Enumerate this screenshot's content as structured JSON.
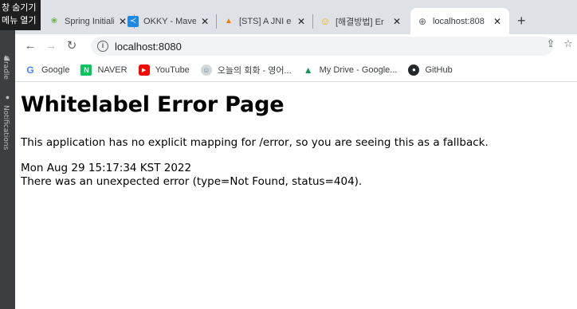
{
  "ide": {
    "tooltip_lines": [
      "창 숨기기",
      "메뉴 열기"
    ],
    "side_tabs": [
      "Gradle",
      "Notifications"
    ]
  },
  "browser": {
    "tabs": [
      {
        "title": "Spring Initiali",
        "favicon": "spring-icon",
        "color": "#6db33f"
      },
      {
        "title": "OKKY - Mave",
        "favicon": "okky-icon",
        "color": "#1e88e5"
      },
      {
        "title": "[STS] A JNI e",
        "favicon": "flame-icon",
        "color": "#f57c00"
      },
      {
        "title": "[해결방법] Er",
        "favicon": "smiley-icon",
        "color": "#f4b400"
      },
      {
        "title": "localhost:808",
        "favicon": "globe-icon",
        "color": "#5f6368",
        "active": true
      }
    ],
    "address": "localhost:8080",
    "bookmarks": [
      {
        "label": "Google",
        "icon": "google-icon",
        "color": "#4285f4"
      },
      {
        "label": "NAVER",
        "icon": "naver-icon",
        "color": "#03c75a"
      },
      {
        "label": "YouTube",
        "icon": "youtube-icon",
        "color": "#ff0000"
      },
      {
        "label": "오늘의 회화 - 영어...",
        "icon": "avatar-icon",
        "color": "#9e9e9e"
      },
      {
        "label": "My Drive - Google...",
        "icon": "drive-icon",
        "color": "#0f9d58"
      },
      {
        "label": "GitHub",
        "icon": "github-icon",
        "color": "#24292e"
      }
    ]
  },
  "page": {
    "heading": "Whitelabel Error Page",
    "message": "This application has no explicit mapping for /error, so you are seeing this as a fallback.",
    "timestamp": "Mon Aug 29 15:17:34 KST 2022",
    "error": "There was an unexpected error (type=Not Found, status=404)."
  }
}
